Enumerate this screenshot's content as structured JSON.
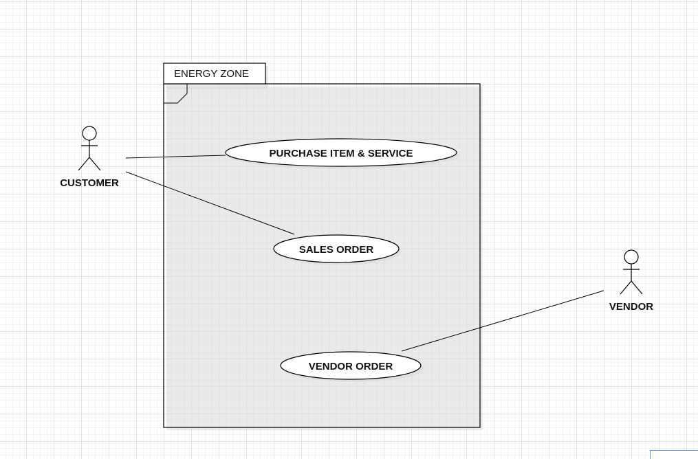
{
  "diagram": {
    "system_boundary": {
      "title": "ENERGY ZONE"
    },
    "actors": [
      {
        "id": "customer",
        "label": "CUSTOMER"
      },
      {
        "id": "vendor",
        "label": "VENDOR"
      }
    ],
    "use_cases": [
      {
        "id": "purchase",
        "label": "PURCHASE ITEM & SERVICE"
      },
      {
        "id": "sales",
        "label": "SALES ORDER"
      },
      {
        "id": "vendor_order",
        "label": "VENDOR ORDER"
      }
    ],
    "associations": [
      {
        "from": "customer",
        "to": "purchase"
      },
      {
        "from": "customer",
        "to": "sales"
      },
      {
        "from": "vendor",
        "to": "vendor_order"
      }
    ]
  },
  "colors": {
    "stroke": "#000000",
    "grid": "#e4e4e4",
    "shadow": "#d9d9d9",
    "selection_border": "#6a8fd8"
  }
}
